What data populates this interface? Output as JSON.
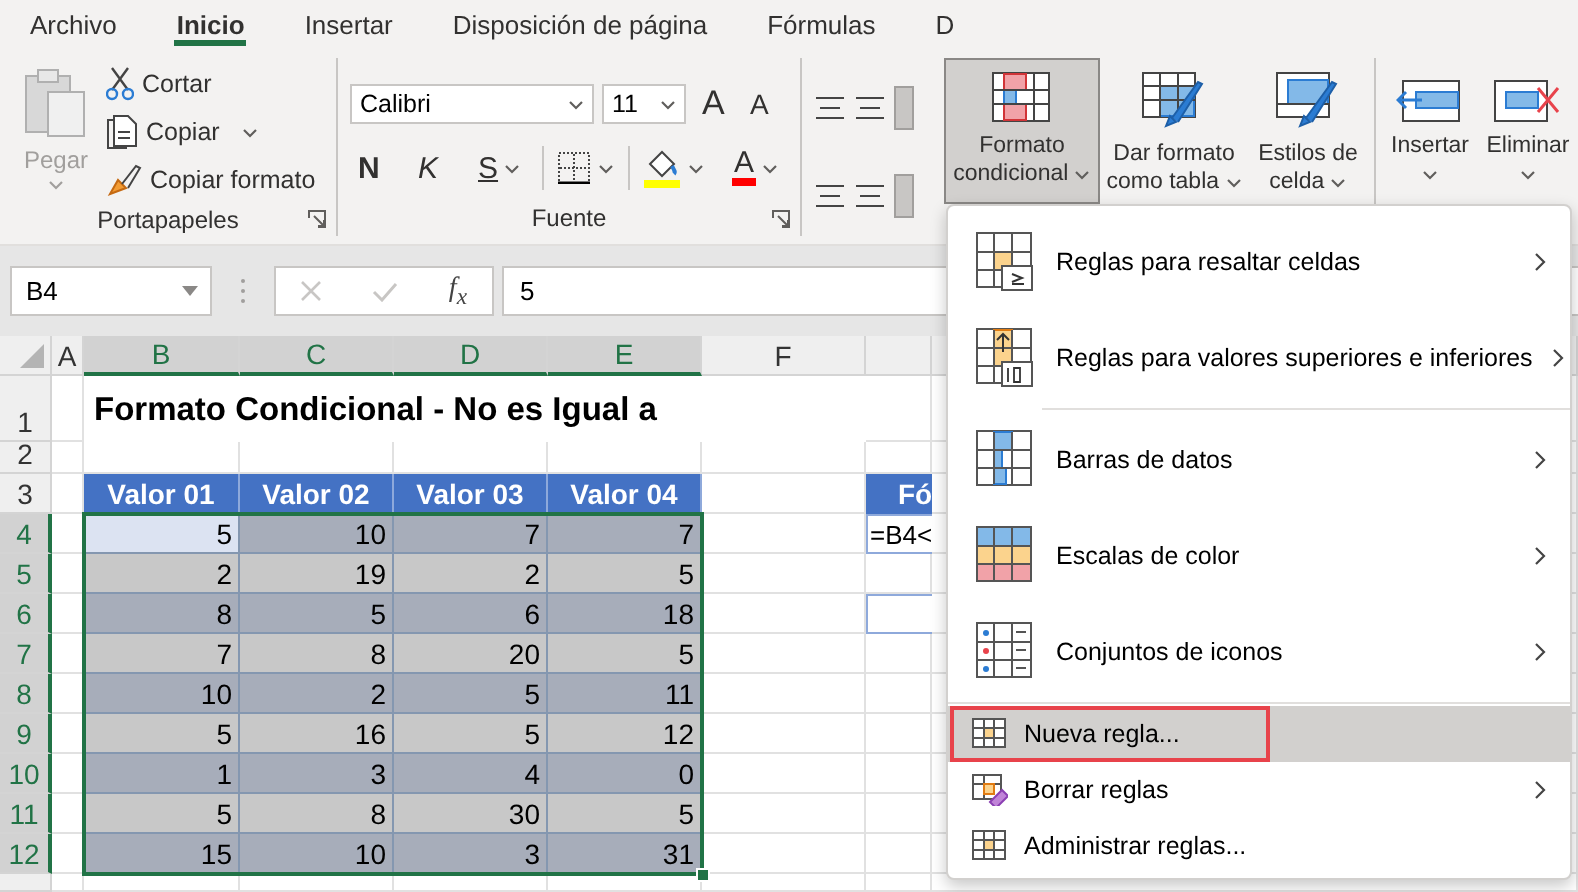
{
  "ribbon_tabs": [
    {
      "label": "Archivo",
      "selected": false
    },
    {
      "label": "Inicio",
      "selected": true
    },
    {
      "label": "Insertar",
      "selected": false
    },
    {
      "label": "Disposición de página",
      "selected": false
    },
    {
      "label": "Fórmulas",
      "selected": false
    },
    {
      "label": "D",
      "selected": false
    }
  ],
  "ribbon": {
    "clipboard": {
      "paste": {
        "label": "Pegar",
        "disabled": true
      },
      "cut": "Cortar",
      "copy": "Copiar",
      "format_painter": "Copiar formato",
      "group_label": "Portapapeles"
    },
    "font": {
      "font_name": "Calibri",
      "font_size": "11",
      "grow_font": "A",
      "shrink_font": "A",
      "bold": "N",
      "italic": "K",
      "underline": "S",
      "font_color": "A",
      "group_label": "Fuente"
    },
    "styles": [
      {
        "label": "Formato condicional",
        "kind": "conditional",
        "selected": true
      },
      {
        "label": "Dar formato como tabla",
        "kind": "table",
        "selected": false
      },
      {
        "label": "Estilos de celda",
        "kind": "cellstyle",
        "selected": false
      }
    ],
    "cells": [
      {
        "label": "Insertar",
        "kind": "insert"
      },
      {
        "label": "Eliminar",
        "kind": "delete"
      }
    ]
  },
  "formula_bar": {
    "name_box": "B4",
    "function_button": "f$_{x}$",
    "formula": "5"
  },
  "sheet": {
    "columns": [
      {
        "label": "A",
        "selected": false
      },
      {
        "label": "B",
        "selected": true
      },
      {
        "label": "C",
        "selected": true
      },
      {
        "label": "D",
        "selected": true
      },
      {
        "label": "E",
        "selected": true
      },
      {
        "label": "F",
        "selected": false
      }
    ],
    "rows": [
      {
        "label": "1",
        "selected": false
      },
      {
        "label": "2",
        "selected": false
      },
      {
        "label": "3",
        "selected": false
      },
      {
        "label": "4",
        "selected": true
      },
      {
        "label": "5",
        "selected": true
      },
      {
        "label": "6",
        "selected": true
      },
      {
        "label": "7",
        "selected": true
      },
      {
        "label": "8",
        "selected": true
      },
      {
        "label": "9",
        "selected": true
      },
      {
        "label": "10",
        "selected": true
      },
      {
        "label": "11",
        "selected": true
      },
      {
        "label": "12",
        "selected": true
      }
    ],
    "title": "Formato Condicional - No es Igual a",
    "table": {
      "headers": [
        "Valor 01",
        "Valor 02",
        "Valor 03",
        "Valor 04"
      ],
      "rows": [
        {
          "shaded": true,
          "cells": [
            {
              "value": "5",
              "active": true
            },
            {
              "value": "10",
              "active": false
            },
            {
              "value": "7",
              "active": false
            },
            {
              "value": "7",
              "active": false
            }
          ]
        },
        {
          "shaded": false,
          "cells": [
            {
              "value": "2",
              "active": false
            },
            {
              "value": "19",
              "active": false
            },
            {
              "value": "2",
              "active": false
            },
            {
              "value": "5",
              "active": false
            }
          ]
        },
        {
          "shaded": true,
          "cells": [
            {
              "value": "8",
              "active": false
            },
            {
              "value": "5",
              "active": false
            },
            {
              "value": "6",
              "active": false
            },
            {
              "value": "18",
              "active": false
            }
          ]
        },
        {
          "shaded": false,
          "cells": [
            {
              "value": "7",
              "active": false
            },
            {
              "value": "8",
              "active": false
            },
            {
              "value": "20",
              "active": false
            },
            {
              "value": "5",
              "active": false
            }
          ]
        },
        {
          "shaded": true,
          "cells": [
            {
              "value": "10",
              "active": false
            },
            {
              "value": "2",
              "active": false
            },
            {
              "value": "5",
              "active": false
            },
            {
              "value": "11",
              "active": false
            }
          ]
        },
        {
          "shaded": false,
          "cells": [
            {
              "value": "5",
              "active": false
            },
            {
              "value": "16",
              "active": false
            },
            {
              "value": "5",
              "active": false
            },
            {
              "value": "12",
              "active": false
            }
          ]
        },
        {
          "shaded": true,
          "cells": [
            {
              "value": "1",
              "active": false
            },
            {
              "value": "3",
              "active": false
            },
            {
              "value": "4",
              "active": false
            },
            {
              "value": "0",
              "active": false
            }
          ]
        },
        {
          "shaded": false,
          "cells": [
            {
              "value": "5",
              "active": false
            },
            {
              "value": "8",
              "active": false
            },
            {
              "value": "30",
              "active": false
            },
            {
              "value": "5",
              "active": false
            }
          ]
        },
        {
          "shaded": true,
          "cells": [
            {
              "value": "15",
              "active": false
            },
            {
              "value": "10",
              "active": false
            },
            {
              "value": "3",
              "active": false
            },
            {
              "value": "31",
              "active": false
            }
          ]
        }
      ]
    },
    "side_table": {
      "header": "Fó",
      "formula": "=B4<"
    }
  },
  "menu": {
    "items": [
      {
        "label": "Reglas para resaltar celdas",
        "kind": "highlight",
        "submenu": true,
        "selected": false,
        "divider_after": false
      },
      {
        "label": "Reglas para valores superiores e inferiores",
        "kind": "topbottom",
        "submenu": true,
        "selected": false,
        "divider_after": true
      },
      {
        "label": "Barras de datos",
        "kind": "databars",
        "submenu": true,
        "selected": false,
        "divider_after": false
      },
      {
        "label": "Escalas de color",
        "kind": "colorscales",
        "submenu": true,
        "selected": false,
        "divider_after": false
      },
      {
        "label": "Conjuntos de iconos",
        "kind": "iconsets",
        "submenu": true,
        "selected": false,
        "divider_after": true
      },
      {
        "label": "Nueva regla...",
        "kind": "newrule",
        "submenu": false,
        "selected": true,
        "divider_after": false
      },
      {
        "label": "Borrar reglas",
        "kind": "clearrules",
        "submenu": true,
        "selected": false,
        "divider_after": false
      },
      {
        "label": "Administrar reglas...",
        "kind": "managerules",
        "submenu": false,
        "selected": false,
        "divider_after": false
      }
    ]
  }
}
